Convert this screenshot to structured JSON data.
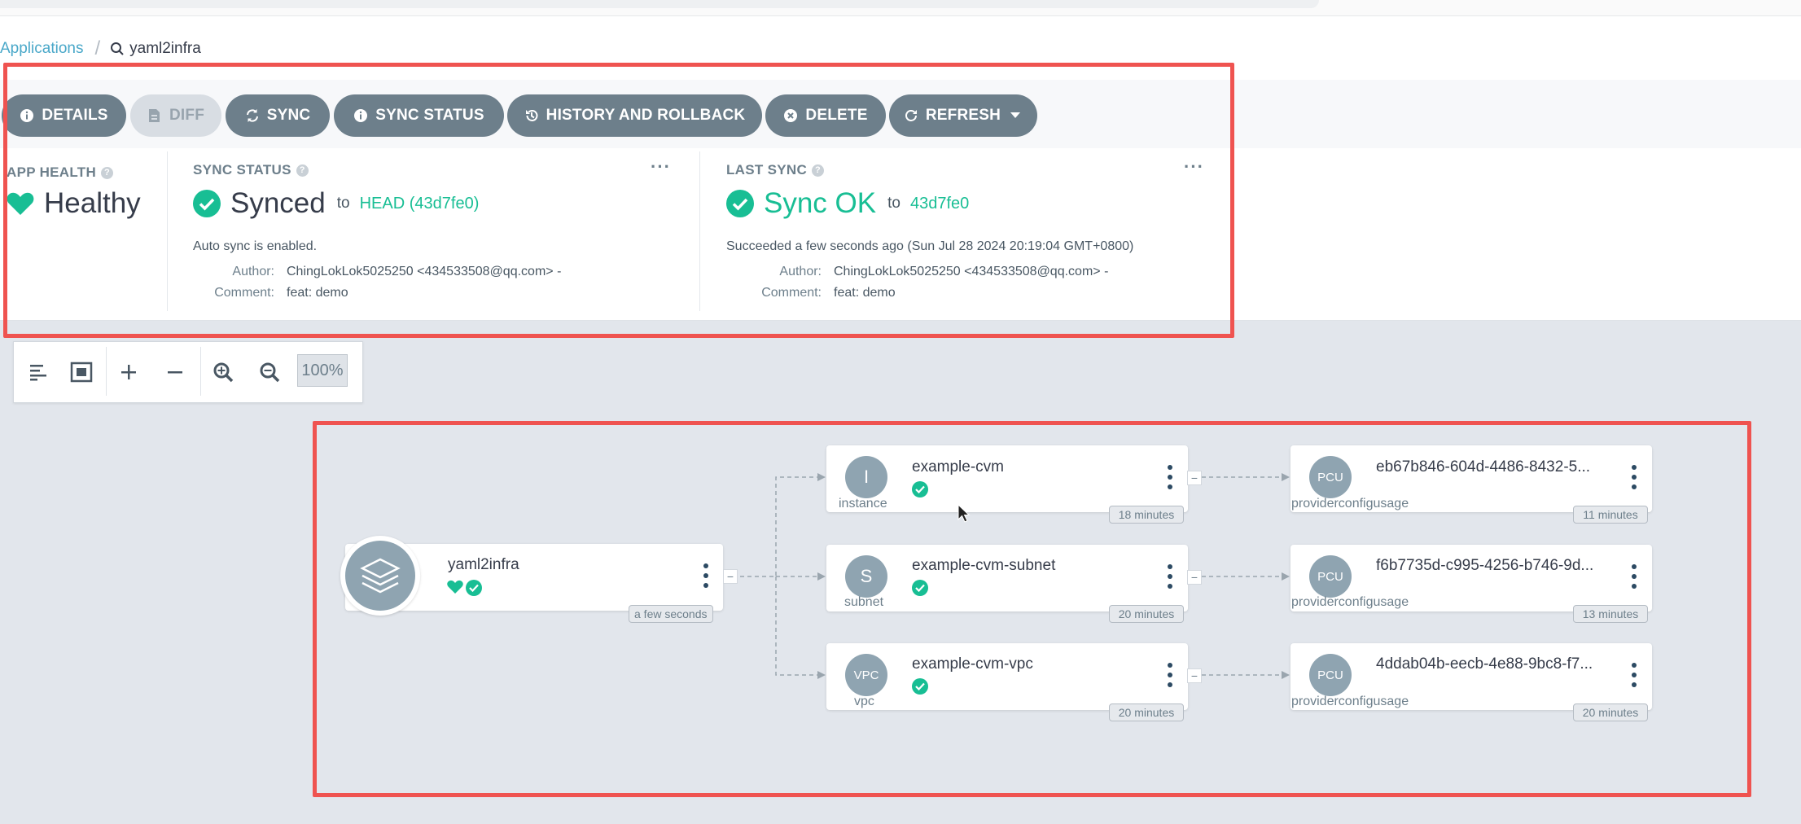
{
  "breadcrumb": {
    "root": "Applications",
    "current": "yaml2infra"
  },
  "actions": {
    "details": "DETAILS",
    "diff": "DIFF",
    "sync": "SYNC",
    "sync_status": "SYNC STATUS",
    "history": "HISTORY AND ROLLBACK",
    "delete": "DELETE",
    "refresh": "REFRESH"
  },
  "app_health": {
    "label": "APP HEALTH",
    "value": "Healthy"
  },
  "sync_status": {
    "label": "SYNC STATUS",
    "value": "Synced",
    "to": "to",
    "revision": "HEAD (43d7fe0)",
    "auto_sync": "Auto sync is enabled.",
    "author_key": "Author:",
    "author": "ChingLokLok5025250 <434533508@qq.com> -",
    "comment_key": "Comment:",
    "comment": "feat: demo"
  },
  "last_sync": {
    "label": "LAST SYNC",
    "value": "Sync OK",
    "to": "to",
    "revision": "43d7fe0",
    "succeeded": "Succeeded a few seconds ago (Sun Jul 28 2024 20:19:04 GMT+0800)",
    "author_key": "Author:",
    "author": "ChingLokLok5025250 <434533508@qq.com> -",
    "comment_key": "Comment:",
    "comment": "feat: demo"
  },
  "zoom": {
    "level": "100%"
  },
  "graph": {
    "app": {
      "name": "yaml2infra",
      "age": "a few seconds"
    },
    "resources": [
      {
        "letter": "I",
        "kind": "instance",
        "name": "example-cvm",
        "age": "18 minutes"
      },
      {
        "letter": "S",
        "kind": "subnet",
        "name": "example-cvm-subnet",
        "age": "20 minutes"
      },
      {
        "letter": "VPC",
        "kind": "vpc",
        "name": "example-cvm-vpc",
        "age": "20 minutes"
      }
    ],
    "usages": [
      {
        "letter": "PCU",
        "kind": "providerconfigusage",
        "name": "eb67b846-604d-4486-8432-5...",
        "age": "11 minutes"
      },
      {
        "letter": "PCU",
        "kind": "providerconfigusage",
        "name": "f6b7735d-c995-4256-b746-9d...",
        "age": "13 minutes"
      },
      {
        "letter": "PCU",
        "kind": "providerconfigusage",
        "name": "4ddab04b-eecb-4e88-9bc8-f7...",
        "age": "20 minutes"
      }
    ]
  },
  "colors": {
    "accent": "#18be94",
    "button": "#6d7f8b",
    "highlight": "#ef5350",
    "link": "#4aa8c9"
  }
}
